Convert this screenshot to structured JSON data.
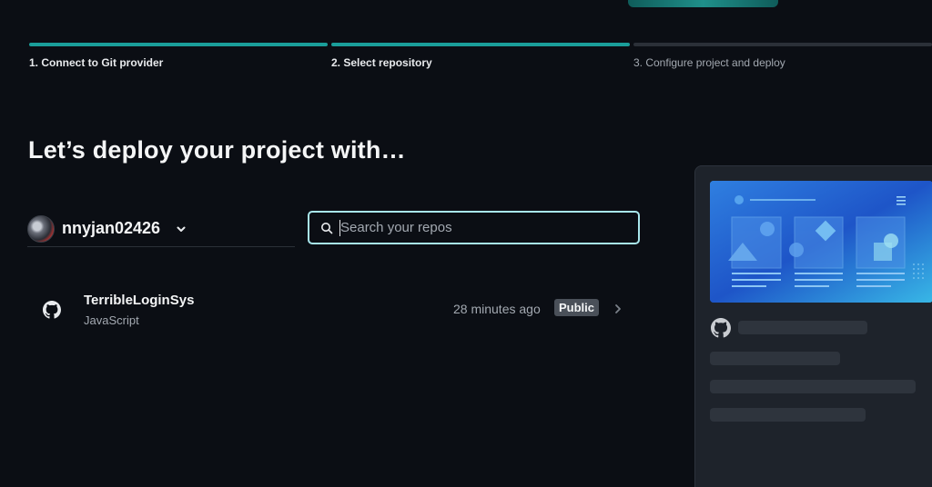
{
  "steps": [
    {
      "label": "1. Connect to Git provider",
      "state": "complete"
    },
    {
      "label": "2. Select repository",
      "state": "complete"
    },
    {
      "label": "3. Configure project and deploy",
      "state": "pending"
    }
  ],
  "heading": "Let’s deploy your project with…",
  "account": {
    "name": "nnyjan02426",
    "icon": "chevron-down-icon"
  },
  "search": {
    "placeholder": "Search your repos",
    "value": ""
  },
  "repos": [
    {
      "name": "TerribleLoginSys",
      "language": "JavaScript",
      "updated": "28 minutes ago",
      "visibility": "Public",
      "icon": "github-icon"
    }
  ],
  "colors": {
    "accent": "#1a9e9a",
    "search_border": "#a8e6ec",
    "background": "#0b0e14",
    "panel": "#1e232b"
  }
}
